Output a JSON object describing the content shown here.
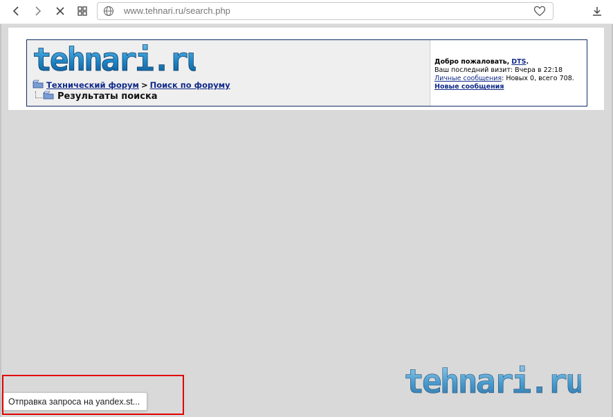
{
  "browser": {
    "url_host": "www.tehnari.ru",
    "url_path": "/search.php",
    "icons": {
      "back": "back-arrow-icon",
      "forward": "forward-arrow-icon",
      "stop": "stop-loading-icon",
      "tabs": "tabs-grid-icon",
      "site_info": "globe-icon",
      "bookmark": "heart-icon",
      "downloads": "download-icon"
    }
  },
  "forum": {
    "logo_text": "tehnari.ru",
    "breadcrumb": {
      "home_label": "Технический форум",
      "separator": ">",
      "search_label": "Поиск по форуму",
      "current_label": "Результаты поиска"
    },
    "welcome": {
      "greeting": "Добро пожаловать,",
      "username": "DTS",
      "username_suffix": ".",
      "last_visit_label": "Ваш последний визит:",
      "last_visit_value": "Вчера",
      "last_visit_in": "в",
      "last_visit_time": "22:18",
      "pm_label": "Личные сообщения",
      "pm_stats": ": Новых 0, всего 708.",
      "new_posts_label": "Новые сообщения"
    },
    "footer_logo_text": "tehnari.ru"
  },
  "status": {
    "text": "Отправка запроса на yandex.st..."
  },
  "colors": {
    "link": "#102a88",
    "logo_blue": "#1f86c6",
    "highlight_frame": "#e00000",
    "page_bg": "#d9d9d9"
  }
}
